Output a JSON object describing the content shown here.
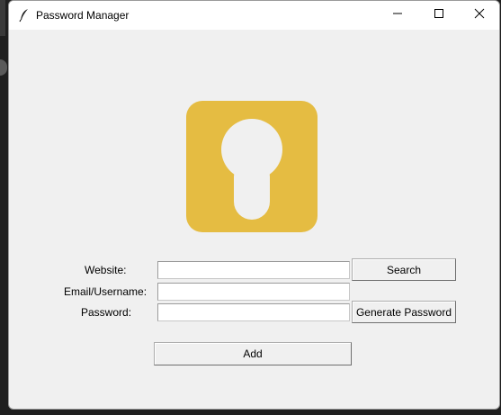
{
  "window": {
    "title": "Password Manager",
    "controls": {
      "minimize_icon": "minimize-icon",
      "maximize_icon": "maximize-icon",
      "close_icon": "close-icon"
    }
  },
  "logo": {
    "icon": "keyhole-lock-icon",
    "color": "#E5BC42"
  },
  "form": {
    "website_label": "Website:",
    "website_value": "",
    "email_label": "Email/Username:",
    "email_value": "",
    "password_label": "Password:",
    "password_value": "",
    "search_label": "Search",
    "generate_label": "Generate Password",
    "add_label": "Add"
  },
  "colors": {
    "window_bg": "#F0F0F0",
    "titlebar_bg": "#FFFFFF",
    "logo_yellow": "#E5BC42"
  }
}
